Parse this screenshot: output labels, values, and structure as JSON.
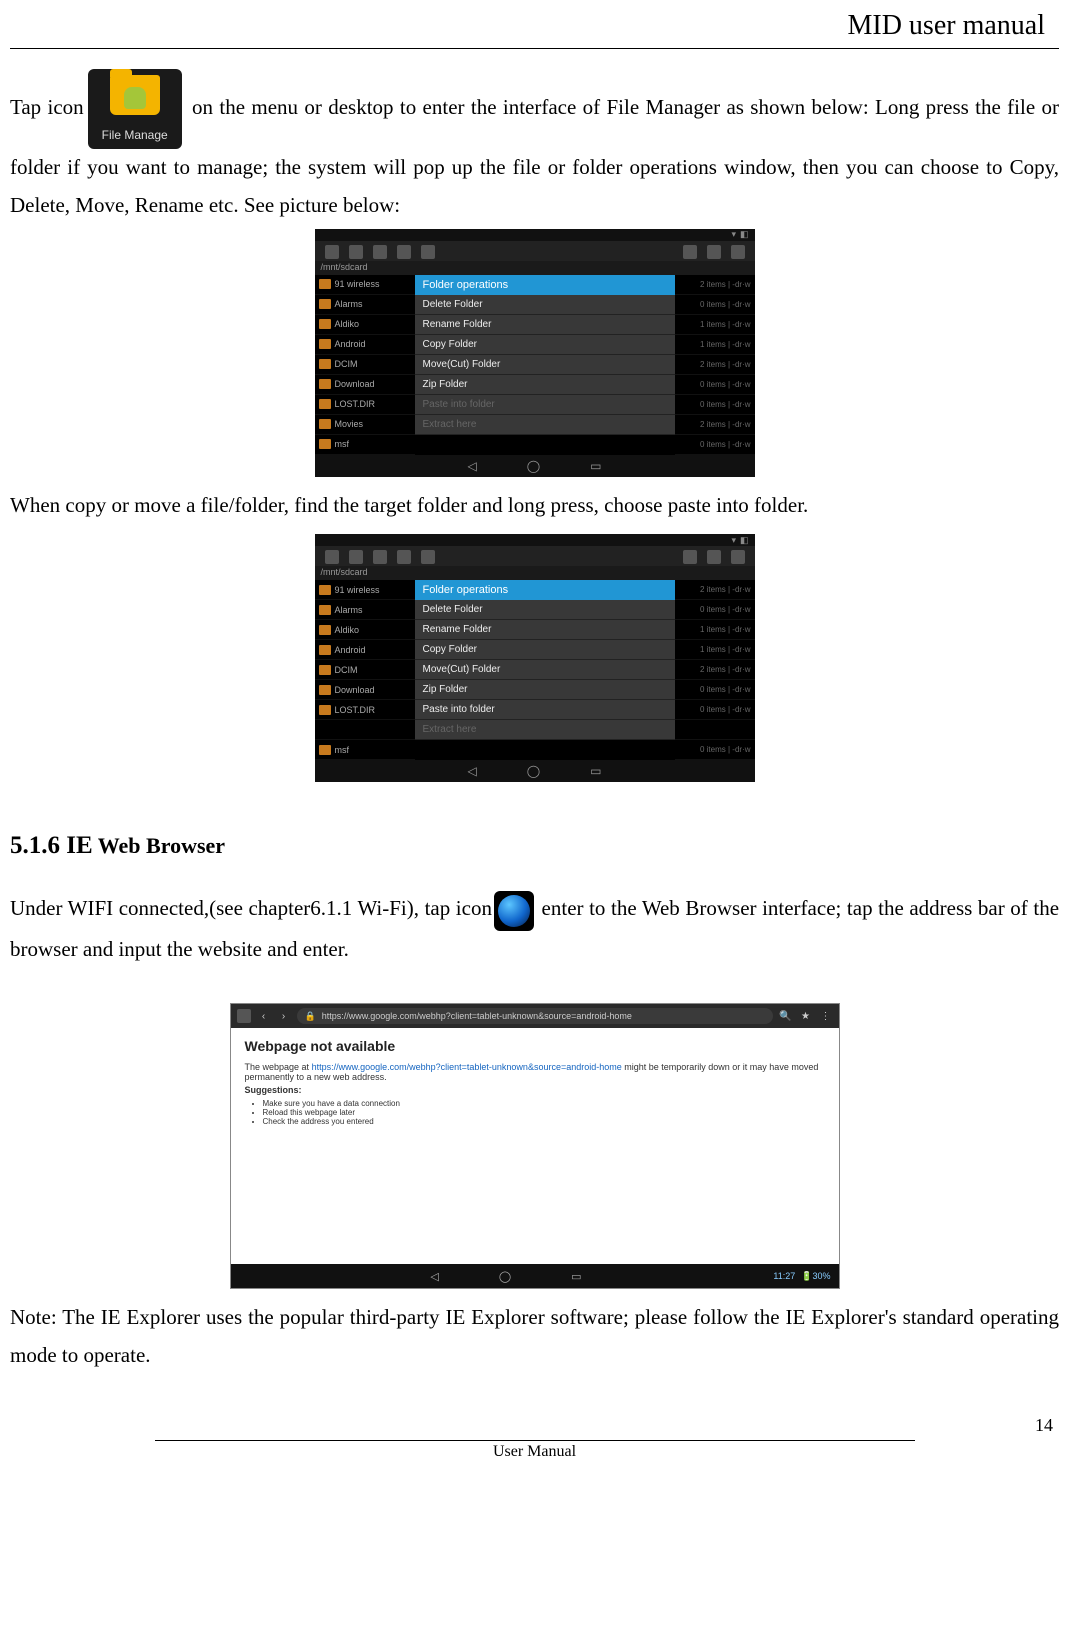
{
  "header": {
    "title": "MID user manual"
  },
  "intro": {
    "pre": "Tap icon",
    "iconLabel": "File Manage",
    "post": "  on the menu or desktop to enter the interface of File Manager as shown below: Long press the file or folder if you want to    manage; the system will pop up the file or folder operations window, then you can choose to Copy, Delete, Move, Rename etc. See picture below:"
  },
  "screenshot1": {
    "path": "/mnt/sdcard",
    "folders": [
      "91 wireless",
      "Alarms",
      "Aldiko",
      "Android",
      "DCIM",
      "Download",
      "LOST.DIR",
      "Movies",
      "msf"
    ],
    "meta": [
      "2 items | -dr·w",
      "0 items | -dr·w",
      "1 items | -dr·w",
      "1 items | -dr·w",
      "2 items | -dr·w",
      "0 items | -dr·w",
      "0 items | -dr·w",
      "2 items | -dr·w",
      "0 items | -dr·w"
    ],
    "popup": {
      "title": "Folder operations",
      "items": [
        "Delete Folder",
        "Rename Folder",
        "Copy Folder",
        "Move(Cut) Folder",
        "Zip Folder"
      ],
      "disabled": [
        "Paste into folder",
        "Extract here"
      ]
    }
  },
  "midText": "When copy or move a file/folder, find the target folder and long press, choose paste into folder.",
  "screenshot2": {
    "path": "/mnt/sdcard",
    "folders": [
      "91 wireless",
      "Alarms",
      "Aldiko",
      "Android",
      "DCIM",
      "Download",
      "LOST.DIR",
      "",
      "msf"
    ],
    "meta": [
      "2 items | -dr·w",
      "0 items | -dr·w",
      "1 items | -dr·w",
      "1 items | -dr·w",
      "2 items | -dr·w",
      "0 items | -dr·w",
      "0 items | -dr·w",
      "",
      "0 items | -dr·w"
    ],
    "popup": {
      "title": "Folder operations",
      "items": [
        "Delete Folder",
        "Rename Folder",
        "Copy Folder",
        "Move(Cut) Folder",
        "Zip Folder",
        "Paste into folder"
      ],
      "disabled": [
        "Extract here"
      ]
    }
  },
  "section": {
    "number": "5.1.6 IE",
    "title": " Web Browser"
  },
  "browserPara": {
    "pre": "Under WIFI connected,(see chapter6.1.1 Wi-Fi), tap icon",
    "post": "  enter to the Web Browser interface; tap the address bar of the browser and input the website and enter."
  },
  "browserShot": {
    "url": "https://www.google.com/webhp?client=tablet-unknown&source=android-home",
    "errTitle": "Webpage not available",
    "errLine1_a": "The webpage at ",
    "errLine1_link": "https://www.google.com/webhp?client=tablet-unknown&source=android-home",
    "errLine1_b": " might be temporarily down or it may have moved permanently to a new web address.",
    "suggLabel": "Suggestions:",
    "sugg": [
      "Make sure you have a data connection",
      "Reload this webpage later",
      "Check the address you entered"
    ],
    "time": "11:27",
    "batt": "30%"
  },
  "note": "Note: The IE Explorer uses the popular third-party IE Explorer software; please follow the IE Explorer's standard operating mode to operate.",
  "footer": {
    "pageNo": "14",
    "label": "User Manual"
  }
}
